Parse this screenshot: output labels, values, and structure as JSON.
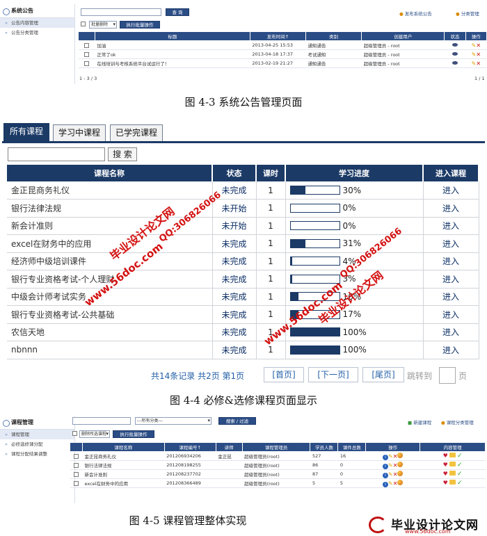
{
  "fig1": {
    "sidebar_title": "系统公告",
    "sidebar_items": [
      "公告内容管理",
      "公告分类管理"
    ],
    "search_button": "查 询",
    "batch_select": "批量删除",
    "batch_button": "执行批量操作",
    "top_links": [
      "发布系统公告",
      "分类管理"
    ],
    "columns": [
      "标题",
      "发布时间↑",
      "类别",
      "创建用户",
      "状态",
      "操作"
    ],
    "rows": [
      {
        "title": "加油",
        "time": "2013-04-25 15:53",
        "type": "通知通告",
        "user": "超级管理员 - root"
      },
      {
        "title": "正常了ok",
        "time": "2013-04-18 17:37",
        "type": "考试通知",
        "user": "超级管理员 - root"
      },
      {
        "title": "在线培训与考核系统平台试运行了！",
        "time": "2013-02-19 21:27",
        "type": "通知通告",
        "user": "超级管理员 - root"
      }
    ],
    "footer_left": "1 - 3 / 3",
    "footer_right": "1 / 1"
  },
  "caption1": "图 4-3  系统公告管理页面",
  "course": {
    "tabs": [
      "所有课程",
      "学习中课程",
      "已学完课程"
    ],
    "search_button": "搜 索",
    "columns": [
      "课程名称",
      "状态",
      "课时",
      "学习进度",
      "进入课程"
    ],
    "rows": [
      {
        "name": "金正昆商务礼仪",
        "status": "未完成",
        "hours": "1",
        "progress": 30,
        "progress_label": "30%",
        "enter": "进入"
      },
      {
        "name": "银行法律法规",
        "status": "未开始",
        "hours": "1",
        "progress": 0,
        "progress_label": "0%",
        "enter": "进入"
      },
      {
        "name": "新会计准则",
        "status": "未开始",
        "hours": "1",
        "progress": 0,
        "progress_label": "0%",
        "enter": "进入"
      },
      {
        "name": "excel在财务中的应用",
        "status": "未完成",
        "hours": "1",
        "progress": 31,
        "progress_label": "31%",
        "enter": "进入"
      },
      {
        "name": "经济师中级培训课件",
        "status": "未完成",
        "hours": "1",
        "progress": 4,
        "progress_label": "4%",
        "enter": "进入"
      },
      {
        "name": "银行专业资格考试-个人理财",
        "status": "未完成",
        "hours": "1",
        "progress": 3,
        "progress_label": "3%",
        "enter": "进入"
      },
      {
        "name": "中级会计师考试实务",
        "status": "未完成",
        "hours": "1",
        "progress": 16,
        "progress_label": "16%",
        "enter": "进入"
      },
      {
        "name": "银行专业资格考试-公共基础",
        "status": "未完成",
        "hours": "1",
        "progress": 17,
        "progress_label": "17%",
        "enter": "进入"
      },
      {
        "name": "农信天地",
        "status": "未完成",
        "hours": "1",
        "progress": 100,
        "progress_label": "100%",
        "enter": "进入"
      },
      {
        "name": "nbnnn",
        "status": "未完成",
        "hours": "1",
        "progress": 100,
        "progress_label": "100%",
        "enter": "进入"
      }
    ],
    "pager": {
      "summary": "共14条记录  共2页  第1页",
      "first": "[首页]",
      "next": "[下一页]",
      "last": "[尾页]",
      "jump_label": "跳转到",
      "page_unit": "页"
    }
  },
  "caption2": "图 4-4  必修&选修课程页面显示",
  "fig3": {
    "sidebar_title": "课程管理",
    "sidebar_items": [
      "课程管理",
      "必修选修课分配",
      "课程分配结果调整"
    ],
    "category_select": "---所有分类---",
    "search_button": "搜索 / 过滤",
    "batch_select": "删除所选课程",
    "batch_button": "执行批量操作",
    "top_links": [
      "新建课程",
      "课程分类管理"
    ],
    "columns": [
      "课程名称",
      "课程编号↑",
      "讲师",
      "课程管理员",
      "学员人数",
      "课件总数",
      "操作",
      "内容管理"
    ],
    "rows": [
      {
        "name": "金正昆商务礼仪",
        "code": "201206934206",
        "teacher": "金正昆",
        "admin": "超级管理员(root)",
        "students": "527",
        "count": "16"
      },
      {
        "name": "银行法律法规",
        "code": "201208198255",
        "teacher": "",
        "admin": "超级管理员(root)",
        "students": "86",
        "count": "0"
      },
      {
        "name": "新会计准则",
        "code": "201208237702",
        "teacher": "",
        "admin": "超级管理员(root)",
        "students": "87",
        "count": "0"
      },
      {
        "name": "excel在财务中的应用",
        "code": "201208366489",
        "teacher": "",
        "admin": "超级管理员(root)",
        "students": "5",
        "count": "5"
      }
    ]
  },
  "caption3": "图 4-5 课程管理整体实现",
  "watermarks": {
    "site": "www.56doc.com",
    "cn": "毕业设计论文网",
    "qq": "QQ:306826066"
  },
  "logo": {
    "text": "毕业设计论文网",
    "url": "www.56doc.com"
  }
}
